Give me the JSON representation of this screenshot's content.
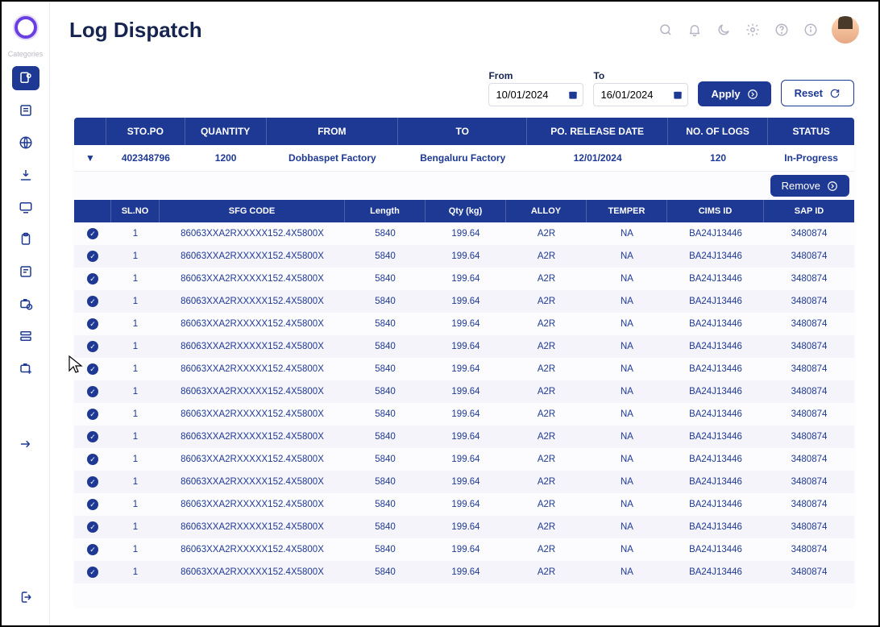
{
  "sidebar": {
    "category_label": "Categories"
  },
  "header": {
    "title": "Log Dispatch"
  },
  "filters": {
    "from_label": "From",
    "from_value": "10/01/2024",
    "to_label": "To",
    "to_value": "16/01/2024",
    "apply_label": "Apply",
    "reset_label": "Reset"
  },
  "summary": {
    "headers": {
      "sto_po": "STO.PO",
      "quantity": "QUANTITY",
      "from": "FROM",
      "to": "TO",
      "release": "PO. RELEASE DATE",
      "logs": "NO. OF LOGS",
      "status": "STATUS"
    },
    "row": {
      "sto_po": "402348796",
      "quantity": "1200",
      "from": "Dobbaspet Factory",
      "to": "Bengaluru Factory",
      "release": "12/01/2024",
      "logs": "120",
      "status": "In-Progress"
    },
    "remove_label": "Remove"
  },
  "detail": {
    "headers": {
      "slno": "SL.NO",
      "sfg": "SFG CODE",
      "length": "Length",
      "qty": "Qty (kg)",
      "alloy": "ALLOY",
      "temper": "TEMPER",
      "cims": "CIMS ID",
      "sap": "SAP ID"
    },
    "row_template": {
      "slno": "1",
      "sfg": "86063XXA2RXXXXX152.4X5800X",
      "length": "5840",
      "qty": "199.64",
      "alloy": "A2R",
      "temper": "NA",
      "cims": "BA24J13446",
      "sap": "3480874"
    },
    "row_count": 16
  }
}
